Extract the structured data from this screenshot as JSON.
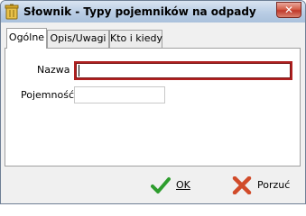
{
  "window": {
    "title": "Słownik - Typy pojemników na odpady",
    "close_glyph": "✕"
  },
  "tabs": [
    {
      "label": "Ogólne",
      "active": true
    },
    {
      "label": "Opis/Uwagi",
      "active": false
    },
    {
      "label": "Kto i kiedy",
      "active": false
    }
  ],
  "form": {
    "nazwa_label": "Nazwa",
    "nazwa_value": "",
    "pojemnosc_label": "Pojemność",
    "pojemnosc_value": ""
  },
  "buttons": {
    "ok_label": "OK",
    "cancel_label": "Porzuć"
  },
  "colors": {
    "focus_border": "#b02020",
    "ok_check": "#2e9d2e",
    "cancel_x": "#d14b2a"
  }
}
